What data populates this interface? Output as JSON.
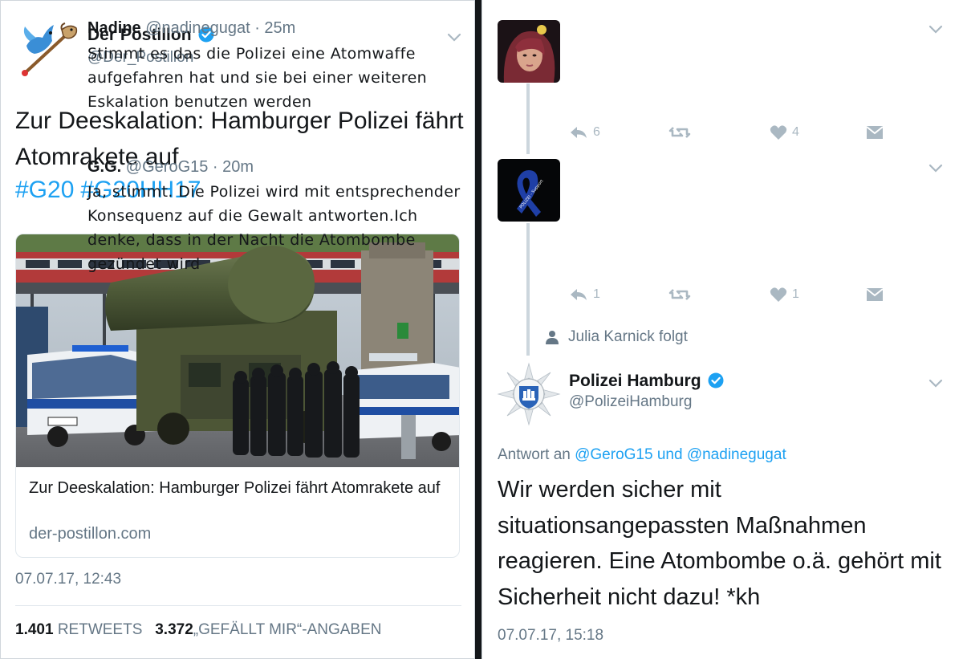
{
  "left_tweet": {
    "author_name": "Der Postillon",
    "author_handle": "@Der_Postillon",
    "text": "Zur Deeskalation: Hamburger Polizei fährt Atomrakete auf",
    "hashtags": [
      "#G20",
      "#G20HH17"
    ],
    "card": {
      "title": "Zur Deeskalation: Hamburger Polizei fährt Atomrakete auf",
      "domain": "der-postillon.com"
    },
    "timestamp": "07.07.17, 12:43",
    "retweets_count": "1.401",
    "retweets_label": "RETWEETS",
    "likes_count": "3.372",
    "likes_label": "„GEFÄLLT MIR“-ANGABEN"
  },
  "thread": {
    "replies": [
      {
        "name": "Nadine",
        "handle": "@nadinegugat · 25m",
        "text": "Stimmt es das die Polizei eine Atomwaffe aufgefahren hat und sie bei einer weiteren Eskalation benutzen werden",
        "reply_count": "6",
        "like_count": "4"
      },
      {
        "name": "G.G.",
        "handle": "@GeroG15 · 20m",
        "text": "Ja, stimmt. Die Polizei wird mit entsprechender Konsequenz auf die Gewalt antworten.Ich denke, dass in der Nacht die Atombombe gezündet wird",
        "reply_count": "1",
        "like_count": "1",
        "avatar_ribbon_text": "POLIZEI - Support"
      }
    ],
    "follow_notice": "Julia Karnick folgt",
    "main": {
      "author_name": "Polizei Hamburg",
      "author_handle": "@PolizeiHamburg",
      "reply_prefix": "Antwort an",
      "reply_to_1": "@GeroG15",
      "reply_and": "und",
      "reply_to_2": "@nadinegugat",
      "text": "Wir werden sicher mit situationsangepassten Maßnahmen reagieren. Eine Atombombe o.ä. gehört mit Sicherheit nicht dazu! *kh",
      "timestamp": "07.07.17, 15:18"
    }
  },
  "colors": {
    "link": "#1da1f2",
    "muted": "#657786",
    "verified": "#1da1f2",
    "divider": "#14171a"
  },
  "icons": [
    "chevron-down-icon",
    "verified-badge-icon",
    "reply-icon",
    "retweet-icon",
    "like-icon",
    "direct-message-icon",
    "person-icon"
  ]
}
